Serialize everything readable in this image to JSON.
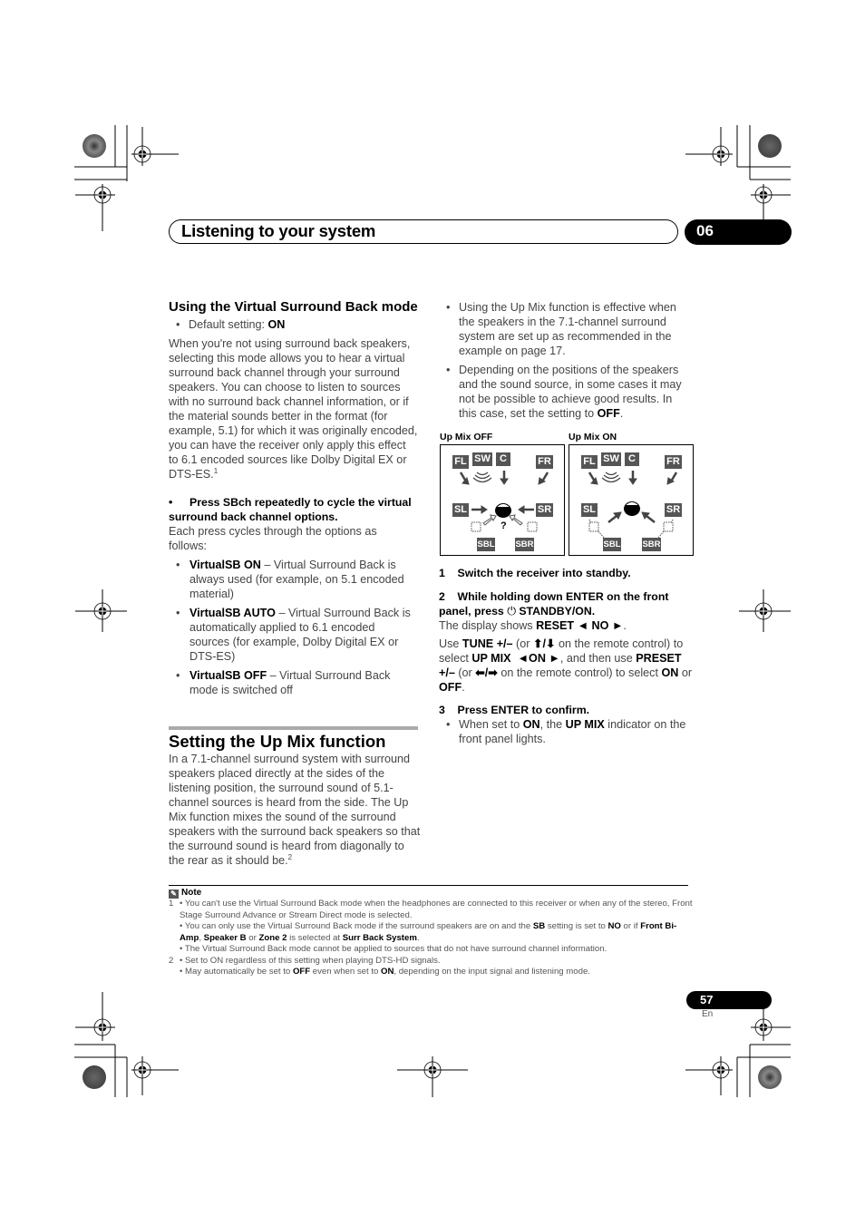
{
  "header": {
    "title": "Listening to your system",
    "chapter": "06"
  },
  "left": {
    "vsb_heading": "Using the Virtual Surround Back mode",
    "default_label": "Default setting: ",
    "default_value": "ON",
    "intro": "When you're not using surround back speakers, selecting this mode allows you to hear a virtual surround back channel through your surround speakers. You can choose to listen to sources with no surround back channel information, or if the material sounds better in the format (for example, 5.1) for which it was originally encoded, you can have the receiver only apply this effect to 6.1 encoded sources like Dolby Digital EX or DTS-ES.",
    "intro_footnote": "1",
    "instruction": "Press SBch repeatedly to cycle the virtual surround back channel options.",
    "cycle_text": "Each press cycles through the options as follows:",
    "options": [
      {
        "name": "VirtualSB ON",
        "desc": " – Virtual Surround Back is always used (for example, on 5.1 encoded material)"
      },
      {
        "name": "VirtualSB AUTO",
        "desc": " – Virtual Surround Back is automatically applied to 6.1 encoded sources (for example, Dolby Digital EX or DTS-ES)"
      },
      {
        "name": "VirtualSB OFF",
        "desc": " – Virtual Surround Back mode is switched off"
      }
    ],
    "upmix_heading": "Setting the Up Mix function",
    "upmix_intro": "In a 7.1-channel surround system with surround speakers placed directly at the sides of the listening position, the surround sound of 5.1-channel sources is heard from the side. The Up Mix function mixes the sound of the surround speakers with the surround back speakers so that the surround sound is heard from diagonally to the rear as it should be.",
    "upmix_footnote": "2"
  },
  "right": {
    "bullets": [
      "Using the Up Mix function is effective when the speakers in the 7.1-channel surround system are set up as recommended in the example on page 17.",
      "Depending on the positions of the speakers and the sound source, in some cases it may not be possible to achieve good results. In this case, set the setting to "
    ],
    "bullet2_bold": "OFF",
    "diagrams": {
      "off_caption": "Up Mix OFF",
      "on_caption": "Up Mix ON",
      "speakers": [
        "FL",
        "SW",
        "C",
        "FR",
        "SL",
        "SR",
        "SBL",
        "SBR"
      ],
      "question": "?"
    },
    "step1": "1    Switch the receiver into standby.",
    "step2_a": "2    While holding down ENTER on the front panel, press ",
    "step2_b": " STANDBY/ON.",
    "display_pre": "The display shows ",
    "display_val": "RESET ◄ NO ►",
    "use_a": "Use ",
    "use_tune": "TUNE +/–",
    "use_b": " (or ",
    "use_updown": "⬆/⬇",
    "use_c": " on the remote control) to select ",
    "use_upmix": "UP MIX  ◄ON ►",
    "use_d": ", and then use ",
    "use_preset": "PRESET +/–",
    "use_e": " (or ",
    "use_lr": "⬅/➡",
    "use_f": " on the remote control) to select ",
    "use_on": "ON",
    "use_g": " or ",
    "use_off": "OFF",
    "use_h": ".",
    "step3": "3    Press ENTER to confirm.",
    "step3_a": "When set to ",
    "step3_on": "ON",
    "step3_b": ", the ",
    "step3_upmix": "UP MIX",
    "step3_c": " indicator on the front panel lights."
  },
  "notes": {
    "title": "Note",
    "n1_num": "1",
    "n1a": "• You can't use the Virtual Surround Back mode when the headphones are connected to this receiver or when any of the stereo, Front Stage Surround Advance or Stream Direct mode is selected.",
    "n1b_a": "• You can only use the Virtual Surround Back mode if the surround speakers are on and the ",
    "n1b_sb": "SB",
    "n1b_b": " setting is set to ",
    "n1b_no": "NO",
    "n1b_c": " or if ",
    "n1b_fba": "Front Bi-Amp",
    "n1b_d": ", ",
    "n1b_spb": "Speaker B",
    "n1b_e": " or ",
    "n1b_z2": "Zone 2",
    "n1b_f": " is selected at ",
    "n1b_sbs": "Surr Back System",
    "n1b_g": ".",
    "n1c": "• The Virtual Surround Back mode cannot be applied to sources that do not have surround channel information.",
    "n2_num": "2",
    "n2a": "• Set to ON regardless of this setting when playing DTS-HD signals.",
    "n2b_a": "• May automatically be set to ",
    "n2b_off": "OFF",
    "n2b_b": " even when set to ",
    "n2b_on": "ON",
    "n2b_c": ", depending on the input signal and listening mode."
  },
  "footer": {
    "page": "57",
    "lang": "En"
  }
}
